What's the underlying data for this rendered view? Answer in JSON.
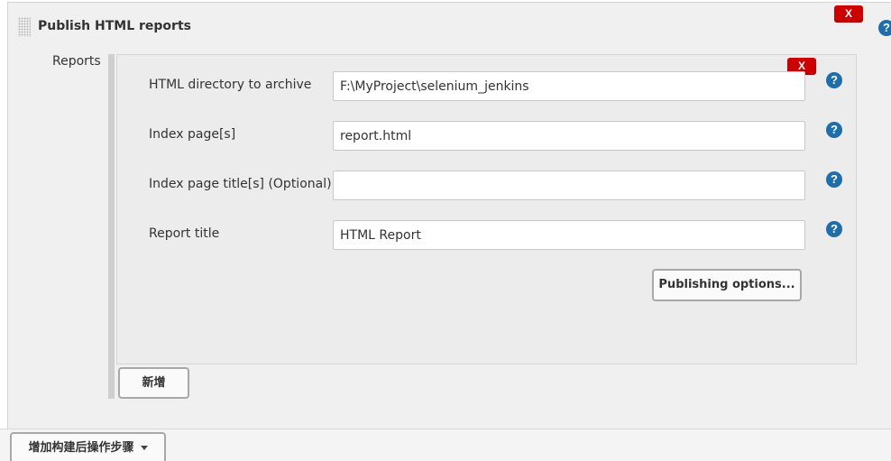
{
  "section": {
    "title": "Publish HTML reports",
    "delete_label": "X",
    "help_symbol": "?"
  },
  "reports": {
    "label": "Reports",
    "block_delete_label": "X",
    "fields": [
      {
        "label": "HTML directory to archive",
        "value": "F:\\MyProject\\selenium_jenkins",
        "help_symbol": "?"
      },
      {
        "label": "Index page[s]",
        "value": "report.html",
        "help_symbol": "?"
      },
      {
        "label": "Index page title[s] (Optional)",
        "value": "",
        "help_symbol": "?"
      },
      {
        "label": "Report title",
        "value": "HTML Report",
        "help_symbol": "?"
      }
    ],
    "publishing_options_label": "Publishing options...",
    "add_label": "新增"
  },
  "footer": {
    "add_post_build_step_label": "增加构建后操作步骤"
  },
  "colors": {
    "delete_red": "#cc0000",
    "help_blue": "#1f6eaa"
  },
  "icons": {
    "drag": "drag-handle-icon",
    "help": "help-icon",
    "dropdown": "caret-down-icon"
  }
}
